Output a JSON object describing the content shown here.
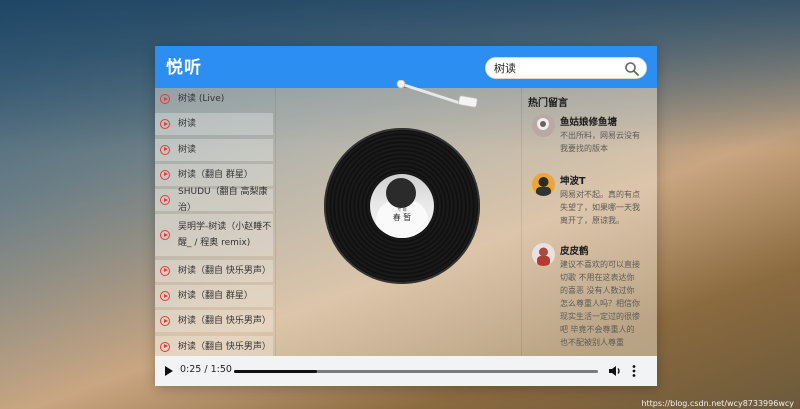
{
  "app": {
    "logo": "悦听"
  },
  "search": {
    "value": "树读"
  },
  "songs": [
    {
      "title": "树读 (Live)"
    },
    {
      "title": "树读"
    },
    {
      "title": "树读"
    },
    {
      "title": "树读（翻自 群星）"
    },
    {
      "title": "SHUDU（翻自 高梨康治）"
    },
    {
      "title": "吴明学-树读（小赵睡不醒_ / 程奥 remix)"
    },
    {
      "title": "树读（翻自 快乐男声）"
    },
    {
      "title": "树读（翻自 群星）"
    },
    {
      "title": "树读（翻自 快乐男声）"
    },
    {
      "title": "树读（翻自 快乐男声）"
    }
  ],
  "album": {
    "cover_text": "春 暂",
    "cover_sub": "专 辑"
  },
  "comments": {
    "title": "热门留言",
    "items": [
      {
        "name": "鱼姑娘修鱼塘",
        "text": "不出所料，网易云没有我要找的版本"
      },
      {
        "name": "坤波T",
        "text": "网易对不起。真的有点失望了，如果哪一天我离开了，原谅我。"
      },
      {
        "name": "皮皮鹤",
        "text": "建议不喜欢的可以直接切歌 不用在这表达你的喜恶 没有人数过你怎么尊重人吗？相信你现实生活一定过的很惨吧 毕竟不会尊重人的也不配被别人尊重"
      }
    ]
  },
  "audio": {
    "time": "0:25 / 1:50",
    "progress": 0.227
  },
  "watermark": "https://blog.csdn.net/wcy8733996wcy",
  "colors": {
    "header": "#2c8ef0",
    "play_icon": "#e23b3b"
  }
}
